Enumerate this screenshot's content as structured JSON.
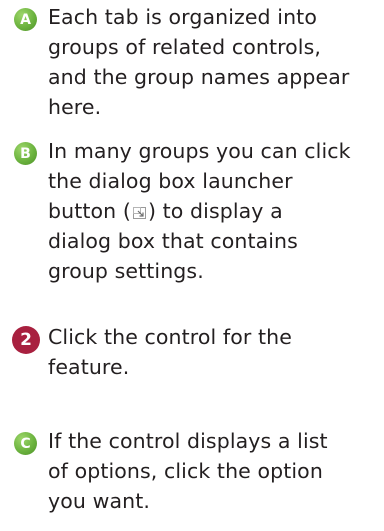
{
  "steps": [
    {
      "badge": "A",
      "lines": [
        "Each tab is organized into",
        "groups of related controls,",
        "and the group names appear",
        "here."
      ]
    },
    {
      "badge": "B",
      "lines": [
        "In many groups you can click",
        "the dialog box launcher",
        "button (",
        ") to display a",
        "dialog box that contains",
        "group settings."
      ]
    },
    {
      "badge": "2",
      "lines": [
        "Click the control for the",
        "feature."
      ]
    },
    {
      "badge": "C",
      "lines": [
        "If the control displays a list",
        "of options, click the option",
        "you want."
      ]
    }
  ],
  "icons": {
    "launcher": "dialog-box-launcher-icon"
  },
  "colors": {
    "letter_badge": "#6cb33f",
    "number_badge": "#a8203f",
    "text": "#231f20"
  }
}
